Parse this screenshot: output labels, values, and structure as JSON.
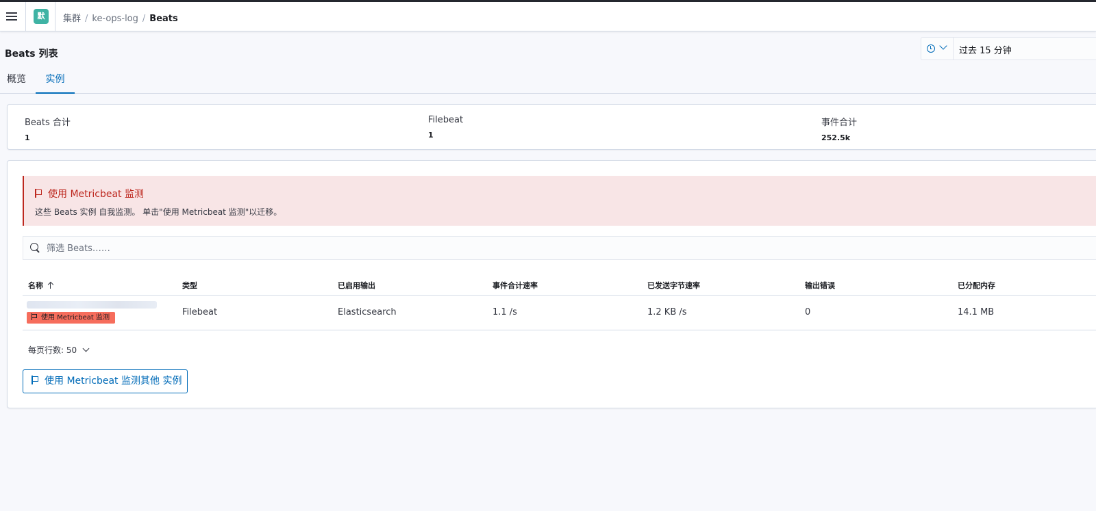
{
  "header": {
    "space_avatar": "默",
    "breadcrumbs": [
      "集群",
      "ke-ops-log",
      "Beats"
    ]
  },
  "page": {
    "title": "Beats 列表"
  },
  "time_picker": {
    "label": "过去 15 分钟",
    "icon": "clock-icon"
  },
  "tabs": [
    {
      "label": "概览",
      "active": false
    },
    {
      "label": "实例",
      "active": true
    }
  ],
  "stats": [
    {
      "label": "Beats 合计",
      "value": "1"
    },
    {
      "label": "Filebeat",
      "value": "1"
    },
    {
      "label": "事件合计",
      "value": "252.5k"
    }
  ],
  "callout": {
    "title": "使用 Metricbeat 监测",
    "text": "这些 Beats 实例 自我监测。 单击\"使用 Metricbeat 监测\"以迁移。",
    "color": "#bd271e"
  },
  "search": {
    "placeholder": "筛选 Beats……"
  },
  "table": {
    "columns": [
      "名称",
      "类型",
      "已启用输出",
      "事件合计速率",
      "已发送字节速率",
      "输出错误",
      "已分配内存"
    ],
    "rows": [
      {
        "badge": "使用 Metricbeat 监测",
        "type": "Filebeat",
        "output": "Elasticsearch",
        "event_rate": "1.1 /s",
        "bytes_rate": "1.2 KB /s",
        "errors": "0",
        "memory": "14.1 MB"
      }
    ]
  },
  "pagination": {
    "rows_per_page": "每页行数: 50"
  },
  "actions": {
    "migrate_button": "使用 Metricbeat 监测其他 实例"
  },
  "colors": {
    "accent": "#006bb8",
    "danger": "#bd271e",
    "badge": "#f66d5c",
    "avatar": "#3fb3a4"
  }
}
